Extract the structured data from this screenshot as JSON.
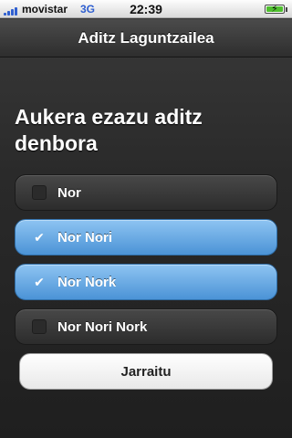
{
  "status_bar": {
    "carrier": "movistar",
    "network": "3G",
    "time": "22:39",
    "battery_level": 1.0
  },
  "header": {
    "title": "Aditz Laguntzailea"
  },
  "main": {
    "heading": "Aukera ezazu aditz denbora",
    "options": [
      {
        "label": "Nor",
        "checked": false
      },
      {
        "label": "Nor Nori",
        "checked": true
      },
      {
        "label": "Nor Nork",
        "checked": true
      },
      {
        "label": "Nor Nori Nork",
        "checked": false
      }
    ],
    "continue_label": "Jarraitu"
  },
  "colors": {
    "accent_checked": "#5aa0df",
    "background": "#2a2a2a"
  },
  "icons": {
    "check": "checkmark-icon",
    "signal": "signal-icon",
    "battery": "battery-icon"
  }
}
